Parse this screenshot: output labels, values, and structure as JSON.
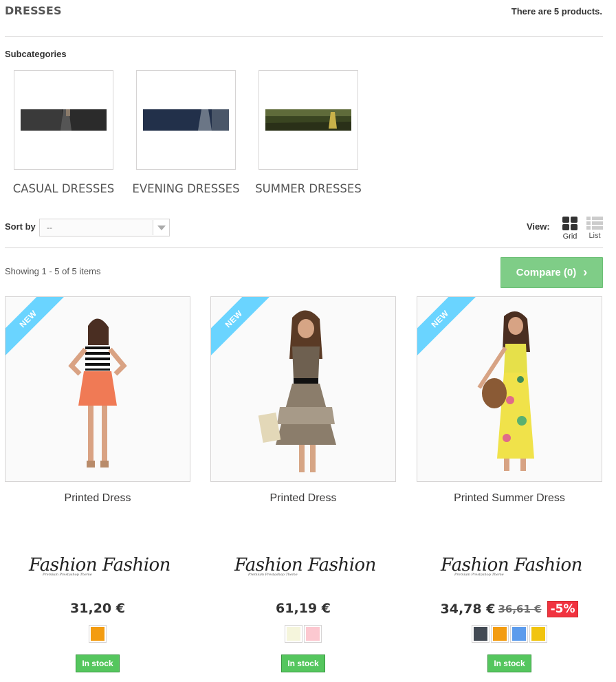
{
  "page": {
    "title": "DRESSES",
    "counter": "There are 5 products."
  },
  "subcategories": {
    "title": "Subcategories",
    "items": [
      {
        "name": "CASUAL DRESSES",
        "icon": "casual-dresses-image",
        "colors": [
          "#2a2a2a",
          "#4a4a4a"
        ]
      },
      {
        "name": "EVENING DRESSES",
        "icon": "evening-dresses-image",
        "colors": [
          "#1e2a3a",
          "#3b4a5c"
        ]
      },
      {
        "name": "SUMMER DRESSES",
        "icon": "summer-dresses-image",
        "colors": [
          "#2f3a1f",
          "#5c6b2a"
        ]
      }
    ]
  },
  "sort": {
    "label": "Sort by",
    "value": "--"
  },
  "view": {
    "label": "View:",
    "grid": "Grid",
    "list": "List"
  },
  "listing": {
    "showing": "Showing 1 - 5 of 5 items",
    "compare": "Compare (0)"
  },
  "products": [
    {
      "badge": "NEW",
      "name": "Printed Dress",
      "brand": "Fashion Fashion",
      "brand_tag": "Premium Prestashop Theme",
      "price": "31,20 €",
      "old_price": "",
      "reduction": "",
      "colors": [
        "#f39c11"
      ],
      "availability": "In stock"
    },
    {
      "badge": "NEW",
      "name": "Printed Dress",
      "brand": "Fashion Fashion",
      "brand_tag": "Premium Prestashop Theme",
      "price": "61,19 €",
      "old_price": "",
      "reduction": "",
      "colors": [
        "#f5f5dc",
        "#fcc8d0"
      ],
      "availability": "In stock"
    },
    {
      "badge": "NEW",
      "name": "Printed Summer Dress",
      "brand": "Fashion Fashion",
      "brand_tag": "Premium Prestashop Theme",
      "price": "34,78 €",
      "old_price": "36,61 €",
      "reduction": "-5%",
      "colors": [
        "#434a54",
        "#f39c11",
        "#5d9cec",
        "#f1c40f"
      ],
      "availability": "In stock"
    }
  ],
  "theme": {
    "accent_new": "#6ad4ff",
    "stock_green": "#55c65e",
    "compare_green": "#7fcd87",
    "sale_red": "#f13340"
  }
}
